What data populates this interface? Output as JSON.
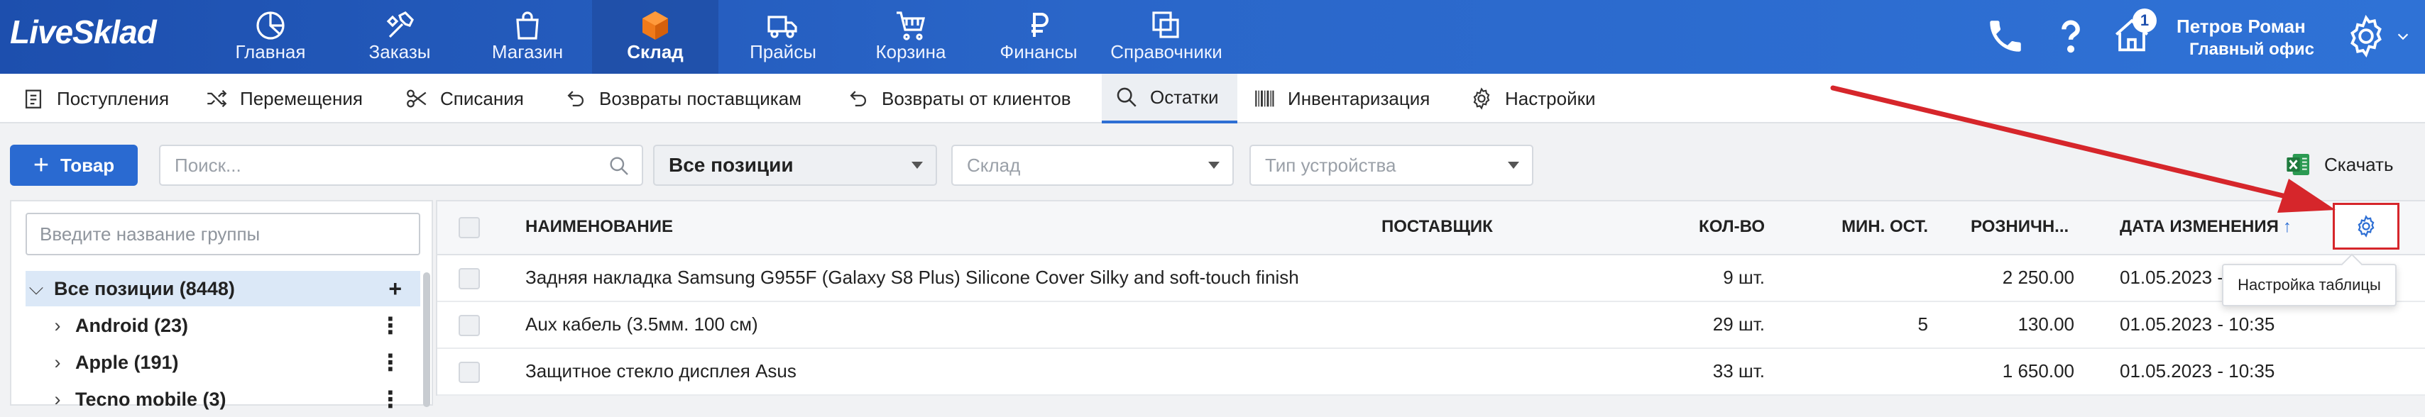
{
  "app": {
    "logo": "LiveSklad"
  },
  "main_nav": [
    {
      "label": "Главная",
      "icon": "chart-pie-icon"
    },
    {
      "label": "Заказы",
      "icon": "hammer-tools-icon"
    },
    {
      "label": "Магазин",
      "icon": "shopping-bag-icon"
    },
    {
      "label": "Склад",
      "icon": "box-icon",
      "active": true
    },
    {
      "label": "Прайсы",
      "icon": "truck-icon"
    },
    {
      "label": "Корзина",
      "icon": "cart-icon"
    },
    {
      "label": "Финансы",
      "icon": "ruble-icon"
    },
    {
      "label": "Справочники",
      "icon": "copy-icon"
    }
  ],
  "user": {
    "name": "Петров Роман",
    "office": "Главный офис",
    "notifications": "1"
  },
  "sub_nav": [
    {
      "label": "Поступления",
      "icon": "clipboard-icon"
    },
    {
      "label": "Перемещения",
      "icon": "shuffle-icon"
    },
    {
      "label": "Списания",
      "icon": "scissors-icon"
    },
    {
      "label": "Возвраты поставщикам",
      "icon": "return-icon"
    },
    {
      "label": "Возвраты от клиентов",
      "icon": "return-icon"
    },
    {
      "label": "Остатки",
      "icon": "search-icon",
      "active": true
    },
    {
      "label": "Инвентаризация",
      "icon": "barcode-icon"
    },
    {
      "label": "Настройки",
      "icon": "gear-icon"
    }
  ],
  "toolbar": {
    "add_button": "Товар",
    "search_placeholder": "Поиск...",
    "positions_select": "Все позиции",
    "warehouse_select": "Склад",
    "device_type_select": "Тип устройства",
    "download": "Скачать"
  },
  "groups": {
    "search_placeholder": "Введите название группы",
    "items": [
      {
        "label": "Все позиции (8448)",
        "selected": true
      },
      {
        "label": "Android (23)"
      },
      {
        "label": "Apple (191)"
      },
      {
        "label": "Tecno mobile (3)"
      }
    ]
  },
  "table": {
    "columns": {
      "name": "НАИМЕНОВАНИЕ",
      "supplier": "ПОСТАВЩИК",
      "qty": "КОЛ-ВО",
      "min_stock": "МИН. ОСТ.",
      "retail": "РОЗНИЧН...",
      "changed": "ДАТА ИЗМЕНЕНИЯ"
    },
    "sort_indicator": "↑",
    "rows": [
      {
        "name": "Задняя накладка Samsung G955F (Galaxy S8 Plus) Silicone Cover Silky and soft-touch finish",
        "supplier": "",
        "qty": "9 шт.",
        "min_stock": "",
        "retail": "2 250.00",
        "changed": "01.05.2023 - 10:35"
      },
      {
        "name": "Aux кабель (3.5мм. 100 см)",
        "supplier": "",
        "qty": "29 шт.",
        "min_stock": "5",
        "retail": "130.00",
        "changed": "01.05.2023 - 10:35"
      },
      {
        "name": "Защитное стекло дисплея Asus",
        "supplier": "",
        "qty": "33 шт.",
        "min_stock": "",
        "retail": "1 650.00",
        "changed": "01.05.2023 - 10:35"
      }
    ],
    "settings_tooltip": "Настройка таблицы"
  },
  "colors": {
    "brand_blue": "#2a66c9",
    "accent": "#2e6fd4",
    "annotation_red": "#d6262b",
    "excel_green": "#1f7a3d"
  }
}
